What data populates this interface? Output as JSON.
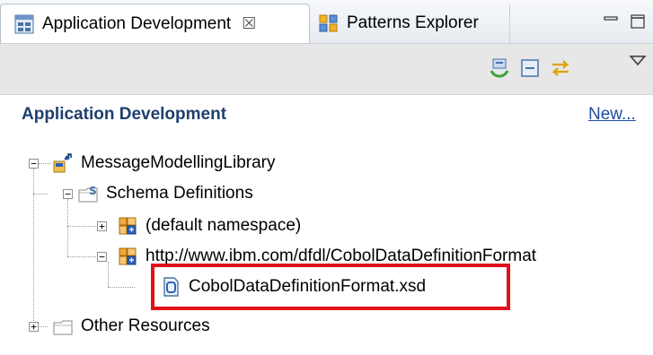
{
  "tabs": [
    {
      "label": "Application Development",
      "close_glyph": "☒",
      "icon": "application-development-icon",
      "active": true
    },
    {
      "label": "Patterns Explorer",
      "icon": "patterns-explorer-icon",
      "active": false
    }
  ],
  "window_controls": [
    "minimize-icon",
    "maximize-icon"
  ],
  "toolbar": {
    "icons": [
      "collapse-all-icon",
      "link-with-editor-icon",
      "sync-icon"
    ],
    "menu_icon": "view-menu-icon"
  },
  "header": {
    "title": "Application Development",
    "new_link": "New..."
  },
  "tree": {
    "library": {
      "label": "MessageModellingLibrary",
      "icon": "message-library-icon",
      "expander": "−"
    },
    "schema_definitions": {
      "label": "Schema Definitions",
      "icon": "schema-folder-icon",
      "expander": "−"
    },
    "default_namespace": {
      "label": "(default namespace)",
      "icon": "namespace-icon",
      "expander": "+"
    },
    "cobol_namespace": {
      "label": "http://www.ibm.com/dfdl/CobolDataDefinitionFormat",
      "icon": "namespace-icon",
      "expander": "−"
    },
    "xsd_file": {
      "label": "CobolDataDefinitionFormat.xsd",
      "icon": "xsd-file-icon"
    },
    "other_resources": {
      "label": "Other Resources",
      "icon": "folder-icon",
      "expander": "+"
    }
  },
  "colors": {
    "highlight": "#e0101a",
    "header_title": "#1f3f6e",
    "link": "#1e4ea0"
  }
}
